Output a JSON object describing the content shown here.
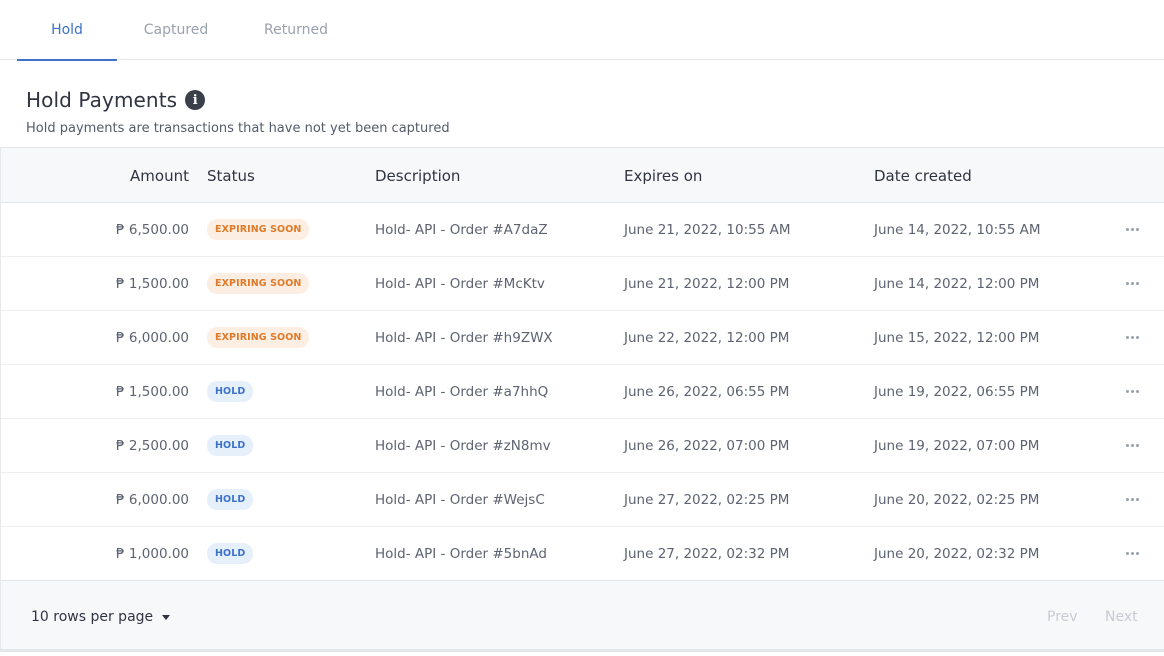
{
  "tabs": [
    {
      "label": "Hold",
      "active": true
    },
    {
      "label": "Captured",
      "active": false
    },
    {
      "label": "Returned",
      "active": false
    }
  ],
  "section": {
    "title": "Hold Payments",
    "info_icon": "info-icon",
    "subtitle": "Hold payments are transactions that have not yet been captured"
  },
  "table": {
    "columns": {
      "amount": "Amount",
      "status": "Status",
      "description": "Description",
      "expires_on": "Expires on",
      "date_created": "Date created"
    },
    "rows": [
      {
        "amount": "₱ 6,500.00",
        "status": "EXPIRING SOON",
        "status_type": "warn",
        "description": "Hold- API - Order #A7daZ",
        "expires_on": "June 21, 2022, 10:55 AM",
        "date_created": "June 14, 2022, 10:55 AM"
      },
      {
        "amount": "₱ 1,500.00",
        "status": "EXPIRING SOON",
        "status_type": "warn",
        "description": "Hold- API - Order #McKtv",
        "expires_on": "June 21, 2022, 12:00 PM",
        "date_created": "June 14, 2022, 12:00 PM"
      },
      {
        "amount": "₱ 6,000.00",
        "status": "EXPIRING SOON",
        "status_type": "warn",
        "description": "Hold- API - Order #h9ZWX",
        "expires_on": "June 22, 2022, 12:00 PM",
        "date_created": "June 15, 2022, 12:00 PM"
      },
      {
        "amount": "₱ 1,500.00",
        "status": "HOLD",
        "status_type": "hold",
        "description": "Hold- API - Order #a7hhQ",
        "expires_on": "June 26, 2022, 06:55 PM",
        "date_created": "June 19, 2022, 06:55 PM"
      },
      {
        "amount": "₱ 2,500.00",
        "status": "HOLD",
        "status_type": "hold",
        "description": "Hold- API - Order #zN8mv",
        "expires_on": "June 26, 2022, 07:00 PM",
        "date_created": "June 19, 2022, 07:00 PM"
      },
      {
        "amount": "₱ 6,000.00",
        "status": "HOLD",
        "status_type": "hold",
        "description": "Hold- API - Order #WejsC",
        "expires_on": "June 27, 2022, 02:25 PM",
        "date_created": "June 20, 2022, 02:25 PM"
      },
      {
        "amount": "₱ 1,000.00",
        "status": "HOLD",
        "status_type": "hold",
        "description": "Hold- API - Order #5bnAd",
        "expires_on": "June 27, 2022, 02:32 PM",
        "date_created": "June 20, 2022, 02:32 PM"
      }
    ],
    "row_action_icon": "more-horizontal-icon"
  },
  "footer": {
    "rows_per_page": "10 rows per page",
    "dropdown_icon": "caret-down-icon",
    "prev": "Prev",
    "next": "Next"
  },
  "colors": {
    "accent": "#3d72c9",
    "warn_text": "#e07b2a",
    "warn_bg": "#fdeee3",
    "hold_bg": "#e6f0fb"
  }
}
